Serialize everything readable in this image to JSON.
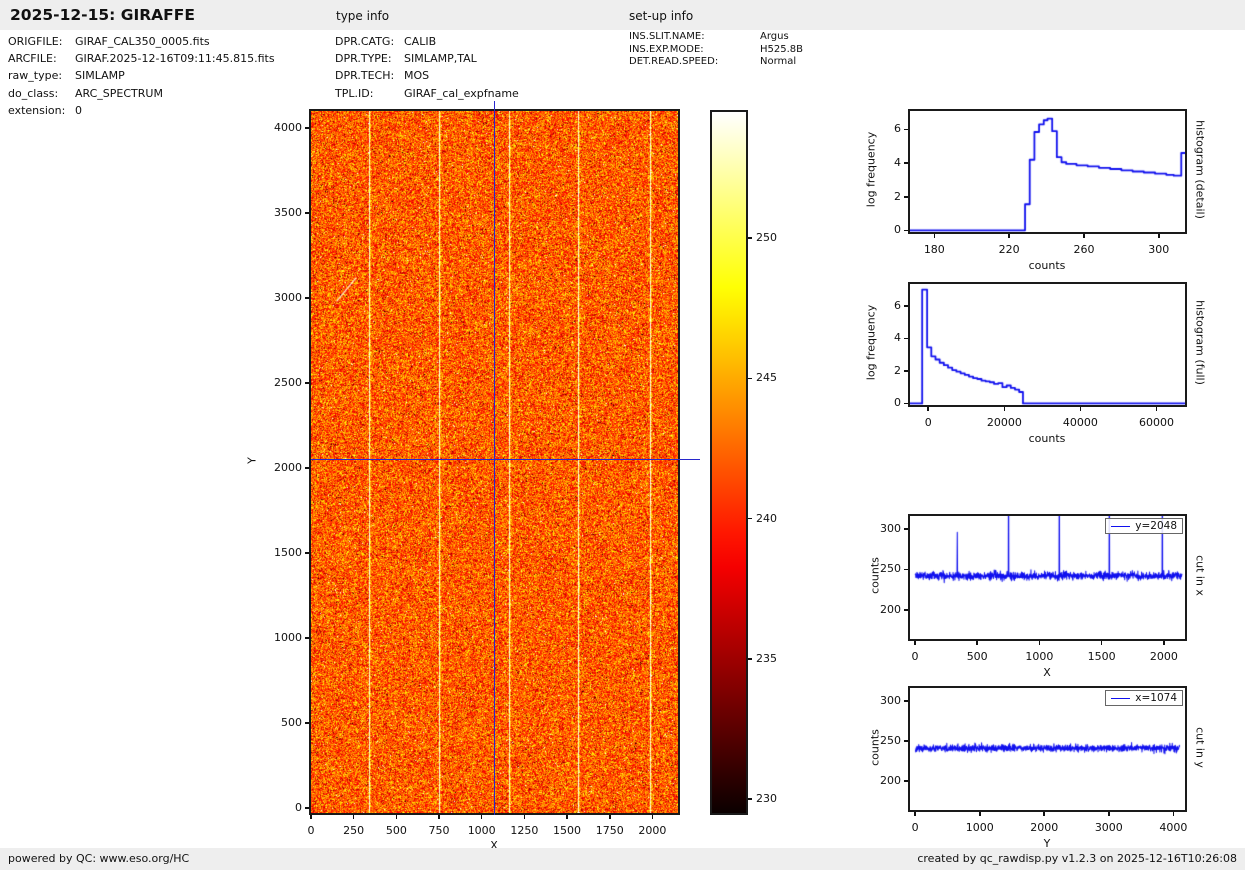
{
  "header": {
    "title": "2025-12-15: GIRAFFE",
    "type_info_heading": "type info",
    "setup_info_heading": "set-up info"
  },
  "file_info": {
    "rows": [
      {
        "label": "ORIGFILE:",
        "value": "GIRAF_CAL350_0005.fits"
      },
      {
        "label": "ARCFILE:",
        "value": "GIRAF.2025-12-16T09:11:45.815.fits"
      },
      {
        "label": "raw_type:",
        "value": "SIMLAMP"
      },
      {
        "label": "do_class:",
        "value": "ARC_SPECTRUM"
      },
      {
        "label": "extension:",
        "value": "0"
      }
    ]
  },
  "type_info": {
    "rows": [
      {
        "label": "DPR.CATG:",
        "value": "CALIB"
      },
      {
        "label": "DPR.TYPE:",
        "value": "SIMLAMP,TAL"
      },
      {
        "label": "DPR.TECH:",
        "value": "MOS"
      },
      {
        "label": "TPL.ID:",
        "value": "GIRAF_cal_expfname"
      }
    ]
  },
  "setup_info": {
    "rows": [
      {
        "label": "INS.SLIT.NAME:",
        "value": "Argus"
      },
      {
        "label": "INS.EXP.MODE:",
        "value": "H525.8B"
      },
      {
        "label": "DET.READ.SPEED:",
        "value": "Normal"
      }
    ]
  },
  "footer": {
    "left": "powered by QC: www.eso.org/HC",
    "right": "created by qc_rawdisp.py v1.2.3 on 2025-12-16T10:26:08"
  },
  "colors": {
    "curve_blue": "#1010ee",
    "crosshair_blue": "#2828cc",
    "frame_black": "#1a1a1a",
    "panel_gray": "#eeeeee"
  },
  "chart_data": [
    {
      "id": "main",
      "type": "heatmap",
      "xlabel": "X",
      "ylabel": "Y",
      "xlim": [
        0,
        2150
      ],
      "ylim": [
        -30,
        4100
      ],
      "xticks": [
        0,
        250,
        500,
        750,
        1000,
        1250,
        1500,
        1750,
        2000
      ],
      "yticks": [
        0,
        500,
        1000,
        1500,
        2000,
        2500,
        3000,
        3500,
        4000
      ],
      "colormap": "hot",
      "display_range": [
        229.5,
        254.5
      ],
      "background": {
        "mean": 242,
        "std": 3.1
      },
      "bright_line_x": [
        340,
        750,
        1158,
        1562,
        1987
      ],
      "crosshair": {
        "x": 1074,
        "y": 2048
      },
      "streak": {
        "x": [
          150,
          265
        ],
        "y": [
          2980,
          3120
        ]
      }
    },
    {
      "id": "colorbar",
      "type": "colorbar",
      "colormap": "hot",
      "range": [
        229.5,
        254.5
      ],
      "ticks": [
        230,
        235,
        240,
        245,
        250
      ]
    },
    {
      "id": "hist_detail",
      "type": "line",
      "right_label": "histogram (detail)",
      "xlabel": "counts",
      "ylabel": "log frequency",
      "xlim": [
        167,
        314
      ],
      "ylim": [
        -0.1,
        7.1
      ],
      "xticks": [
        180,
        220,
        260,
        300
      ],
      "yticks": [
        0,
        2,
        4,
        6
      ],
      "steps": {
        "edges": [
          228.5,
          231,
          233.5,
          236,
          238.5,
          240.5,
          243,
          245.5,
          248,
          250.5,
          256,
          262,
          268,
          274,
          280,
          286,
          292,
          298,
          304,
          308,
          312,
          316
        ],
        "levels": [
          1.55,
          4.2,
          5.85,
          6.3,
          6.55,
          6.65,
          5.9,
          4.35,
          4.05,
          3.95,
          3.87,
          3.8,
          3.72,
          3.65,
          3.57,
          3.5,
          3.44,
          3.37,
          3.3,
          3.25,
          4.6
        ],
        "close_to_zero": false
      }
    },
    {
      "id": "hist_full",
      "type": "line",
      "right_label": "histogram (full)",
      "xlabel": "counts",
      "ylabel": "log frequency",
      "xlim": [
        -4800,
        67500
      ],
      "ylim": [
        -0.1,
        7.35
      ],
      "xticks": [
        0,
        20000,
        40000,
        60000
      ],
      "yticks": [
        0,
        2,
        4,
        6
      ],
      "steps": {
        "edges": [
          -1600,
          -300,
          800,
          1900,
          3000,
          4100,
          5200,
          6300,
          7400,
          8500,
          9600,
          10700,
          11800,
          12900,
          14000,
          15100,
          16200,
          17300,
          18400,
          19500,
          20600,
          21700,
          22800,
          23900,
          24900
        ],
        "levels": [
          7.0,
          3.45,
          2.9,
          2.7,
          2.5,
          2.35,
          2.2,
          2.05,
          1.95,
          1.85,
          1.75,
          1.65,
          1.55,
          1.5,
          1.4,
          1.35,
          1.3,
          1.2,
          1.25,
          1.0,
          1.1,
          0.95,
          0.85,
          0.7
        ],
        "close_to_zero": true
      }
    },
    {
      "id": "cut_x",
      "type": "line",
      "right_label": "cut in x",
      "xlabel": "X",
      "ylabel": "counts",
      "legend": "y=2048",
      "xlim": [
        -40,
        2170
      ],
      "ylim": [
        164,
        316
      ],
      "xticks": [
        0,
        500,
        1000,
        1500,
        2000
      ],
      "yticks": [
        200,
        250,
        300
      ],
      "baseline": 242,
      "noise_std": 2.4,
      "data_range": [
        2,
        2148
      ],
      "spikes": [
        {
          "x": 340,
          "peak": 296
        },
        {
          "x": 752,
          "peak": 420
        },
        {
          "x": 1160,
          "peak": 420
        },
        {
          "x": 1562,
          "peak": 400
        },
        {
          "x": 1988,
          "peak": 420
        }
      ]
    },
    {
      "id": "cut_y",
      "type": "line",
      "right_label": "cut in y",
      "xlabel": "Y",
      "ylabel": "counts",
      "legend": "x=1074",
      "xlim": [
        -80,
        4180
      ],
      "ylim": [
        164,
        316
      ],
      "xticks": [
        0,
        1000,
        2000,
        3000,
        4000
      ],
      "yticks": [
        200,
        250,
        300
      ],
      "baseline": 241,
      "noise_std": 2.1,
      "data_range": [
        5,
        4096
      ],
      "spikes": []
    }
  ]
}
